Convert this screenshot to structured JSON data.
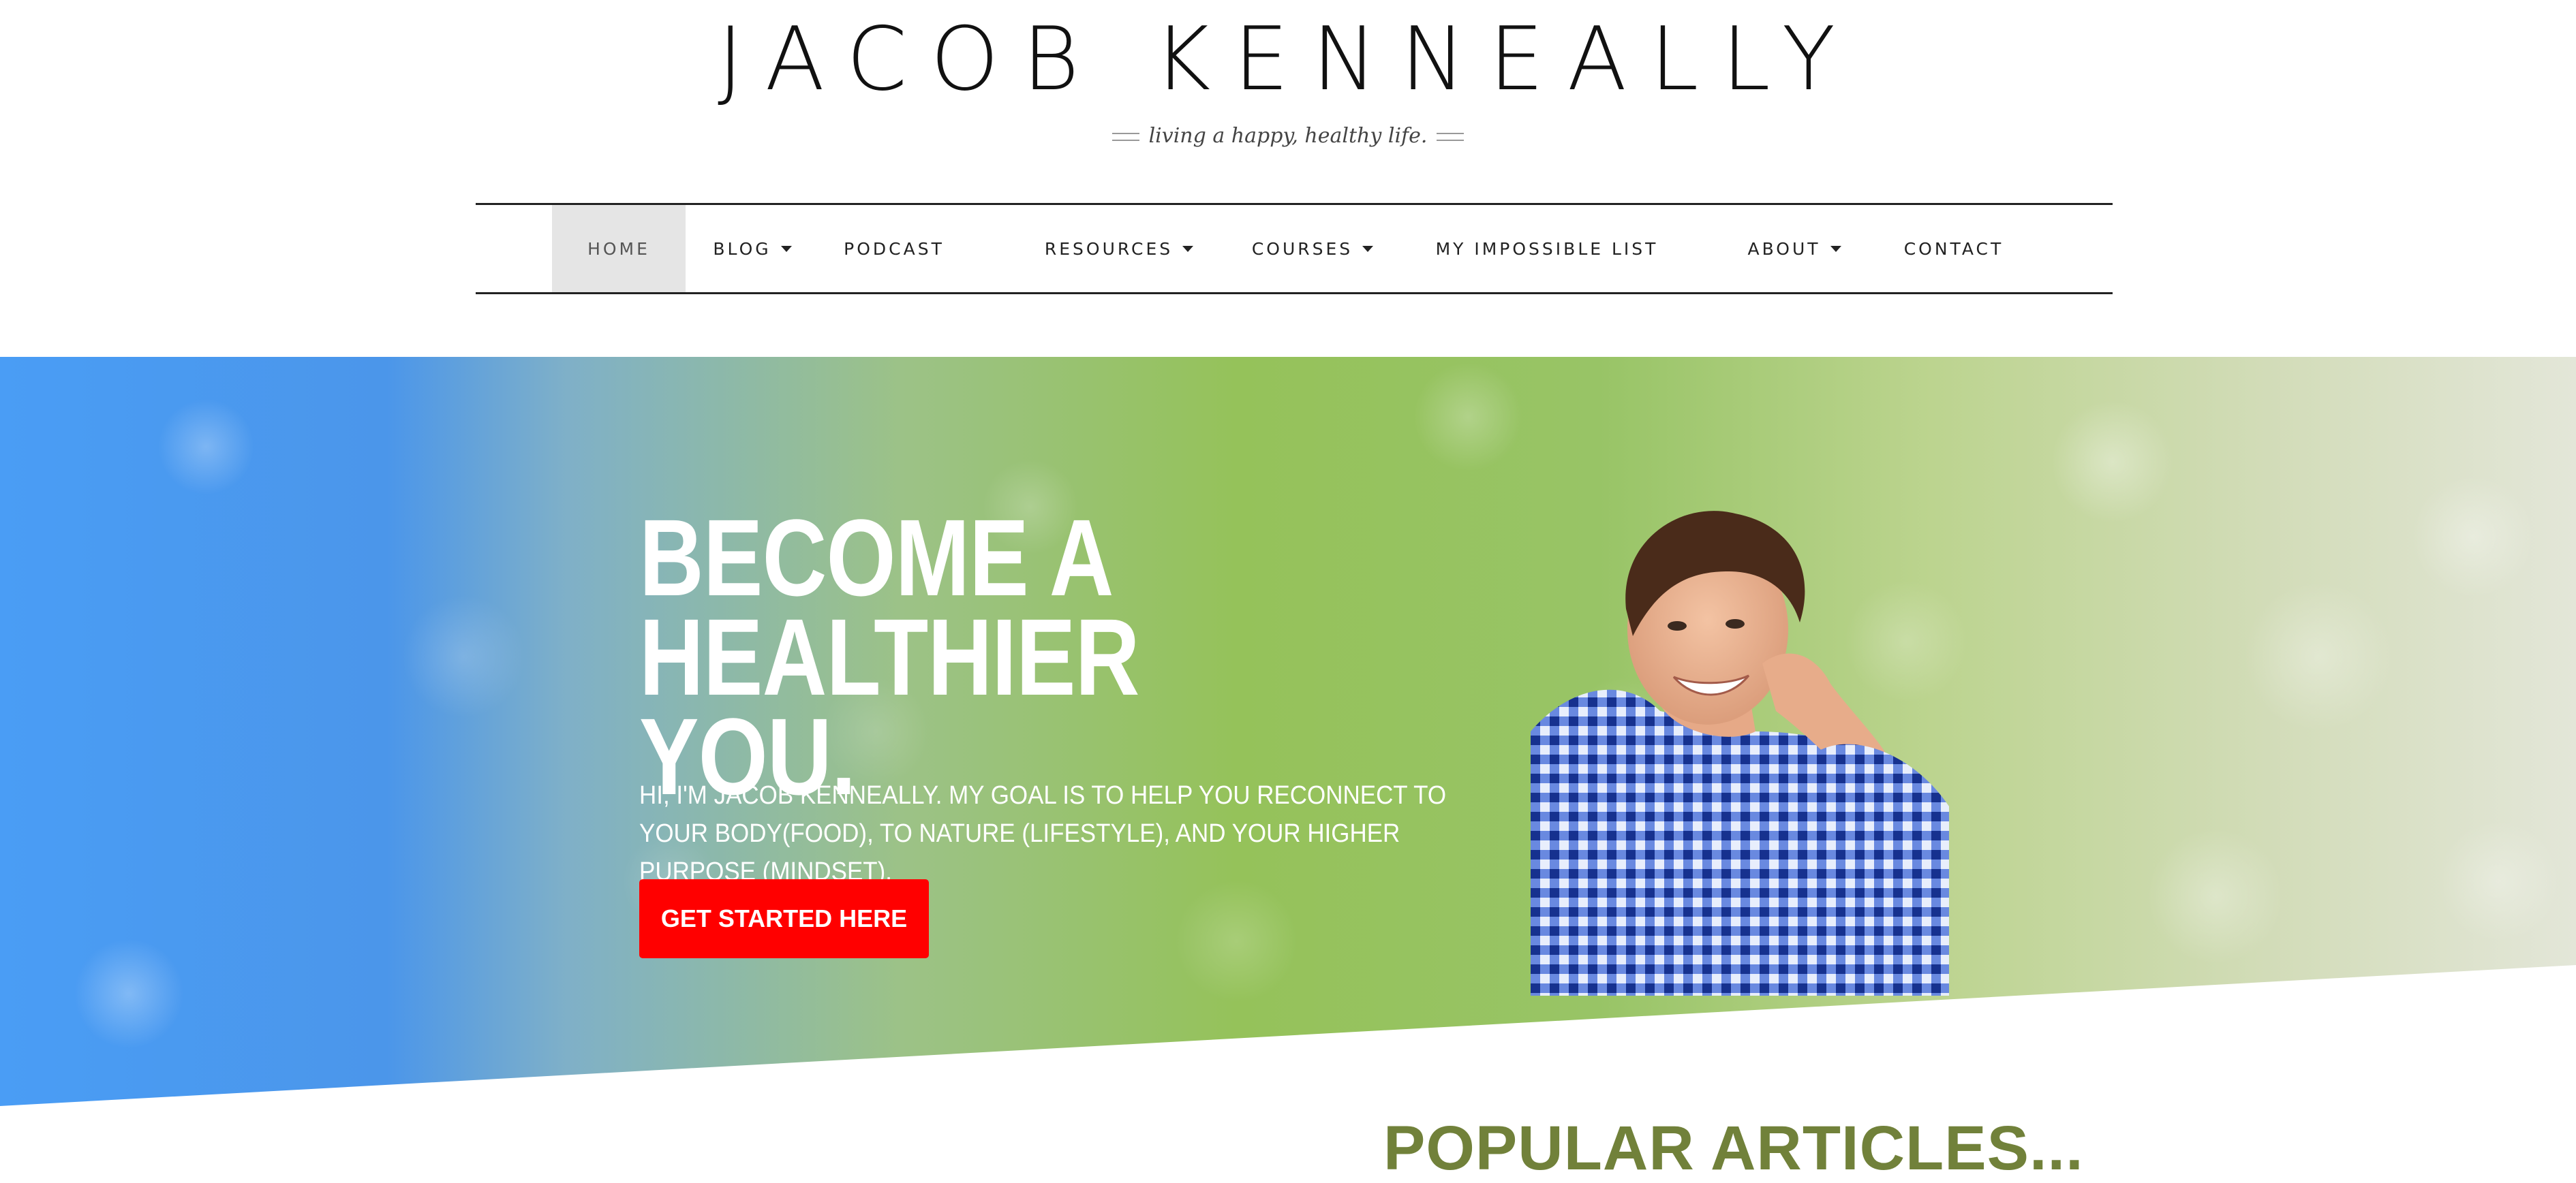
{
  "header": {
    "site_title": "JACOB KENNEALLY",
    "tagline": "living a happy, healthy life."
  },
  "nav": {
    "items": [
      {
        "label": "HOME",
        "has_dropdown": false,
        "active": true
      },
      {
        "label": "BLOG",
        "has_dropdown": true,
        "active": false
      },
      {
        "label": "PODCAST",
        "has_dropdown": false,
        "active": false
      },
      {
        "label": "RESOURCES",
        "has_dropdown": true,
        "active": false
      },
      {
        "label": "COURSES",
        "has_dropdown": true,
        "active": false
      },
      {
        "label": "MY IMPOSSIBLE LIST",
        "has_dropdown": false,
        "active": false
      },
      {
        "label": "ABOUT",
        "has_dropdown": true,
        "active": false
      },
      {
        "label": "CONTACT",
        "has_dropdown": false,
        "active": false
      }
    ]
  },
  "hero": {
    "headline": "BECOME A HEALTHIER YOU.",
    "intro": "HI, I'M JACOB KENNEALLY. MY GOAL IS TO HELP YOU RECONNECT TO YOUR BODY(FOOD), TO NATURE (LIFESTYLE), AND YOUR HIGHER PURPOSE (MINDSET).",
    "cta_label": "GET STARTED HERE"
  },
  "popular": {
    "heading": "POPULAR ARTICLES..."
  },
  "colors": {
    "cta_background": "#ff0000",
    "heading_green": "#71813a",
    "nav_active_background": "#e5e5e5",
    "hero_blue": "#4a9df5",
    "hero_green": "#95c25a"
  },
  "icons": {
    "dropdown": "caret-down-icon",
    "tagline_ornament": "double-dash-ornament"
  }
}
